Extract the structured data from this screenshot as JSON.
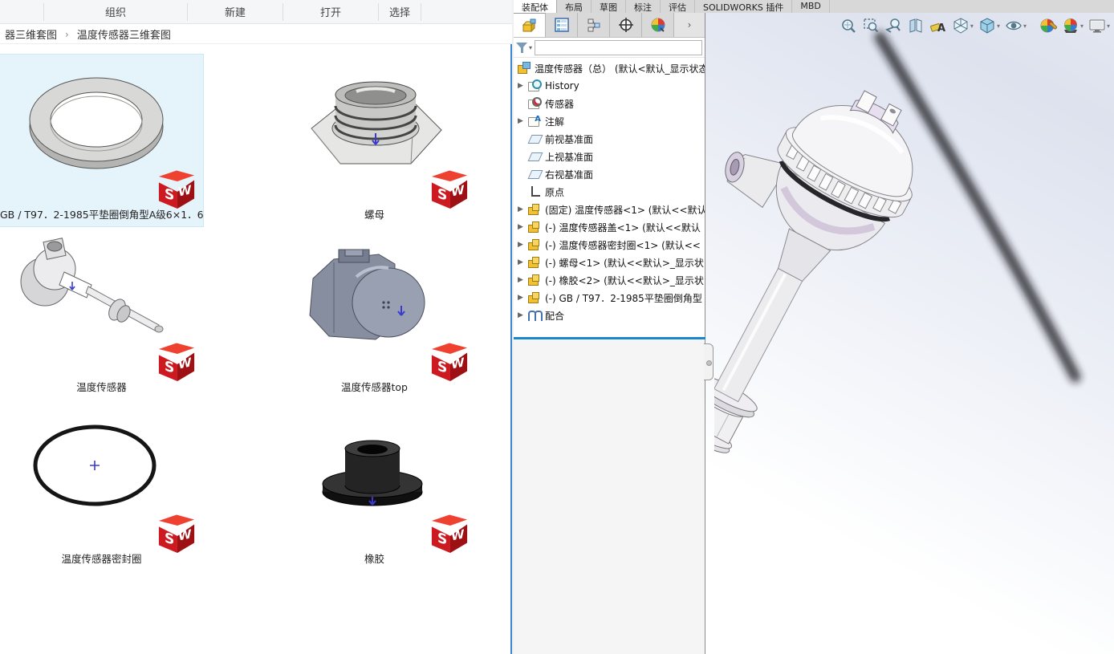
{
  "explorer": {
    "toolbar": {
      "items": [
        {
          "label": "组织"
        },
        {
          "label": "新建"
        },
        {
          "label": "打开"
        },
        {
          "label": "选择"
        }
      ]
    },
    "breadcrumb": {
      "crumbs": [
        "器三维套图",
        "温度传感器三维套图"
      ],
      "separator": "›"
    },
    "items": [
      {
        "label": "GB / T97．2-1985平垫圈倒角型A级6×1．6",
        "selected": true,
        "thumbnail": "washer"
      },
      {
        "label": "螺母",
        "selected": false,
        "thumbnail": "nut"
      },
      {
        "label": "温度传感器",
        "selected": false,
        "thumbnail": "temperature-sensor"
      },
      {
        "label": "温度传感器top",
        "selected": false,
        "thumbnail": "sensor-top-cap"
      },
      {
        "label": "温度传感器密封圈",
        "selected": false,
        "thumbnail": "o-ring-seal"
      },
      {
        "label": "橡胶",
        "selected": false,
        "thumbnail": "rubber-grommet"
      }
    ],
    "badge": {
      "s": "S",
      "w": "W"
    }
  },
  "solidworks": {
    "command_tabs": [
      {
        "label": "装配体",
        "active": true
      },
      {
        "label": "布局",
        "active": false
      },
      {
        "label": "草图",
        "active": false
      },
      {
        "label": "标注",
        "active": false
      },
      {
        "label": "评估",
        "active": false
      },
      {
        "label": "SOLIDWORKS 插件",
        "active": false
      },
      {
        "label": "MBD",
        "active": false
      }
    ],
    "manager_tabs": [
      {
        "icon": "featuremanager-tree-icon",
        "active": true
      },
      {
        "icon": "propertymanager-icon",
        "active": false
      },
      {
        "icon": "configurationmanager-icon",
        "active": false
      },
      {
        "icon": "dimxpertmanager-icon",
        "active": false
      },
      {
        "icon": "displaymanager-icon",
        "active": false
      }
    ],
    "overflow_chevron": "›",
    "filter": {
      "value": "",
      "placeholder": ""
    },
    "tree": {
      "items": [
        {
          "label": "温度传感器（总） (默认<默认_显示状态",
          "icon": "assembly-icon",
          "arrow": false
        },
        {
          "label": "History",
          "icon": "history-folder-icon",
          "arrow": true
        },
        {
          "label": "传感器",
          "icon": "sensors-folder-icon",
          "arrow": false
        },
        {
          "label": "注解",
          "icon": "annotations-folder-icon",
          "arrow": true
        },
        {
          "label": "前视基准面",
          "icon": "plane-icon",
          "arrow": false
        },
        {
          "label": "上视基准面",
          "icon": "plane-icon",
          "arrow": false
        },
        {
          "label": "右视基准面",
          "icon": "plane-icon",
          "arrow": false
        },
        {
          "label": "原点",
          "icon": "origin-icon",
          "arrow": false
        },
        {
          "label": "(固定) 温度传感器<1> (默认<<默认",
          "icon": "part-icon",
          "arrow": true
        },
        {
          "label": "(-) 温度传感器盖<1> (默认<<默认",
          "icon": "part-icon",
          "arrow": true
        },
        {
          "label": "(-) 温度传感器密封圈<1> (默认<<",
          "icon": "part-icon",
          "arrow": true
        },
        {
          "label": "(-) 螺母<1> (默认<<默认>_显示状",
          "icon": "part-icon",
          "arrow": true
        },
        {
          "label": "(-) 橡胶<2> (默认<<默认>_显示状",
          "icon": "part-icon",
          "arrow": true
        },
        {
          "label": "(-) GB / T97．2-1985平垫圈倒角型",
          "icon": "part-icon",
          "arrow": true
        },
        {
          "label": "配合",
          "icon": "mates-paperclip-icon",
          "arrow": true
        }
      ]
    },
    "headsup_toolbar": [
      {
        "icon": "zoom-to-fit-icon",
        "caret": false
      },
      {
        "icon": "zoom-to-area-icon",
        "caret": false
      },
      {
        "icon": "previous-view-icon",
        "caret": false
      },
      {
        "icon": "section-view-icon",
        "caret": false
      },
      {
        "icon": "annotation-view-icon",
        "caret": false
      },
      {
        "icon": "view-orientation-icon",
        "caret": true
      },
      {
        "icon": "display-style-icon",
        "caret": true
      },
      {
        "icon": "hide-show-items-icon",
        "caret": true
      },
      {
        "icon": "edit-appearance-icon",
        "caret": false
      },
      {
        "icon": "apply-scene-icon",
        "caret": true
      },
      {
        "icon": "view-settings-icon",
        "caret": true
      }
    ],
    "colors": {
      "accent_blue": "#1b86ce",
      "explorer_border_blue": "#3c87cf",
      "selection_fill": "#e5f3fb",
      "part_icon_yellow": "#f3c12f",
      "sw_badge_red": "#cc1a20"
    }
  }
}
